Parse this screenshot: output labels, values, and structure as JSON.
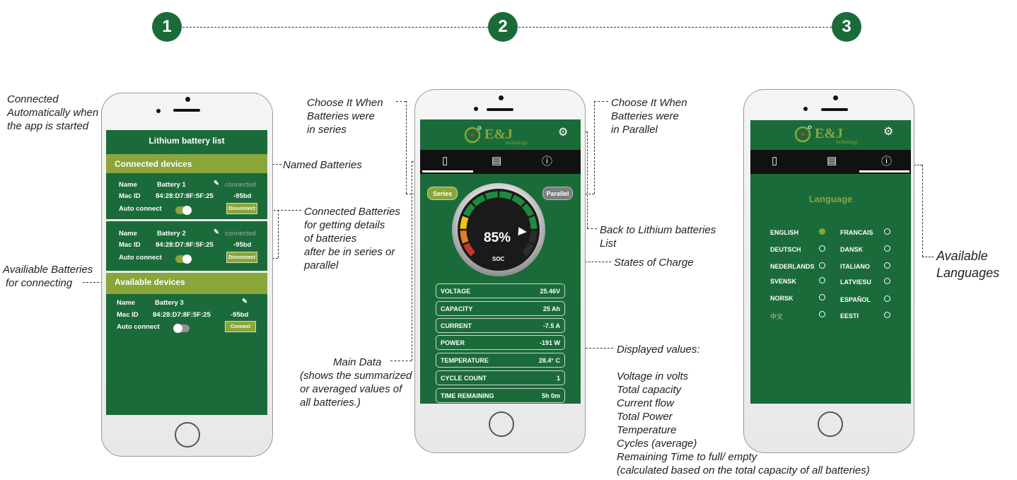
{
  "steps": [
    "1",
    "2",
    "3"
  ],
  "annotations": {
    "connected_auto": [
      "Connected",
      "Automatically when",
      "the app is started"
    ],
    "available_batteries": [
      "Availiable Batteries",
      "for connecting"
    ],
    "choose_series": [
      "Choose It When",
      "Batteries were",
      "in series"
    ],
    "named_batteries": "Named Batteries",
    "connected_batteries": [
      "Connected Batteries",
      "for getting details",
      "of batteries",
      "after be in series or",
      "parallel"
    ],
    "main_data": [
      "Main Data",
      "(shows the summarized",
      "or averaged values of",
      "all batteries.)"
    ],
    "choose_parallel": [
      "Choose It When",
      "Batteries were",
      "in Parallel"
    ],
    "back_to_list": [
      "Back to Lithium batteries",
      "List"
    ],
    "states_of_charge": "States of Charge",
    "displayed_values": [
      "Displayed values:",
      "",
      "Voltage in volts",
      "Total capacity",
      "Current flow",
      "Total Power",
      "Temperature",
      "Cycles (average)",
      "Remaining Time to full/ empty",
      "(calculated based on the total capacity of all batteries)"
    ],
    "available_languages": [
      "Available",
      "Languages"
    ]
  },
  "phone1": {
    "title": "Lithium battery list",
    "connected_header": "Connected devices",
    "available_header": "Available devices",
    "devices": [
      {
        "name_label": "Name",
        "name": "Battery 1",
        "status": "connected",
        "mac_label": "Mac ID",
        "mac": "84:28:D7:8F:5F:25",
        "rssi": "-95bd",
        "auto_label": "Auto connect",
        "auto": true,
        "button": "Disconnect"
      },
      {
        "name_label": "Name",
        "name": "Battery 2",
        "status": "connected",
        "mac_label": "Mac ID",
        "mac": "84:28:D7:8F:5F:25",
        "rssi": "-95bd",
        "auto_label": "Auto connect",
        "auto": true,
        "button": "Disconnect"
      },
      {
        "name_label": "Name",
        "name": "Battery 3",
        "status": "",
        "mac_label": "Mac ID",
        "mac": "84:28:D7:8F:5F:25",
        "rssi": "-95bd",
        "auto_label": "Auto connect",
        "auto": false,
        "button": "Connect"
      }
    ]
  },
  "phone2": {
    "logo": "E&J",
    "logo_sub": "technology",
    "series_label": "Series",
    "parallel_label": "Parallel",
    "soc_value": "85%",
    "soc_label": "SOC",
    "soc_fraction": 0.85,
    "rows": [
      {
        "k": "VOLTAGE",
        "v": "25.46V"
      },
      {
        "k": "CAPACITY",
        "v": "25 Ah"
      },
      {
        "k": "CURRENT",
        "v": "-7.5 A"
      },
      {
        "k": "POWER",
        "v": "-191 W"
      },
      {
        "k": "TEMPERATURE",
        "v": "28.4° C"
      },
      {
        "k": "CYCLE COUNT",
        "v": "1"
      },
      {
        "k": "TIME REMAINING",
        "v": "5h 0m"
      }
    ]
  },
  "phone3": {
    "logo": "E&J",
    "logo_sub": "technology",
    "title": "Language",
    "languages_left": [
      {
        "name": "ENGLISH",
        "selected": true
      },
      {
        "name": "DEUTSCH",
        "selected": false
      },
      {
        "name": "NEDERLANDS",
        "selected": false
      },
      {
        "name": "SVENSK",
        "selected": false
      },
      {
        "name": "NORSK",
        "selected": false
      },
      {
        "name": "中文",
        "selected": false
      }
    ],
    "languages_right": [
      {
        "name": "FRANCAIS",
        "selected": false
      },
      {
        "name": "DANSK",
        "selected": false
      },
      {
        "name": "ITALIANO",
        "selected": false
      },
      {
        "name": "LATVIESU",
        "selected": false
      },
      {
        "name": "ESPAÑOL",
        "selected": false
      },
      {
        "name": "EESTI",
        "selected": false
      }
    ]
  },
  "colors": {
    "brand_green": "#1b6b3a",
    "accent_olive": "#8aa53a",
    "disabled_grey": "#7d7d7d"
  }
}
